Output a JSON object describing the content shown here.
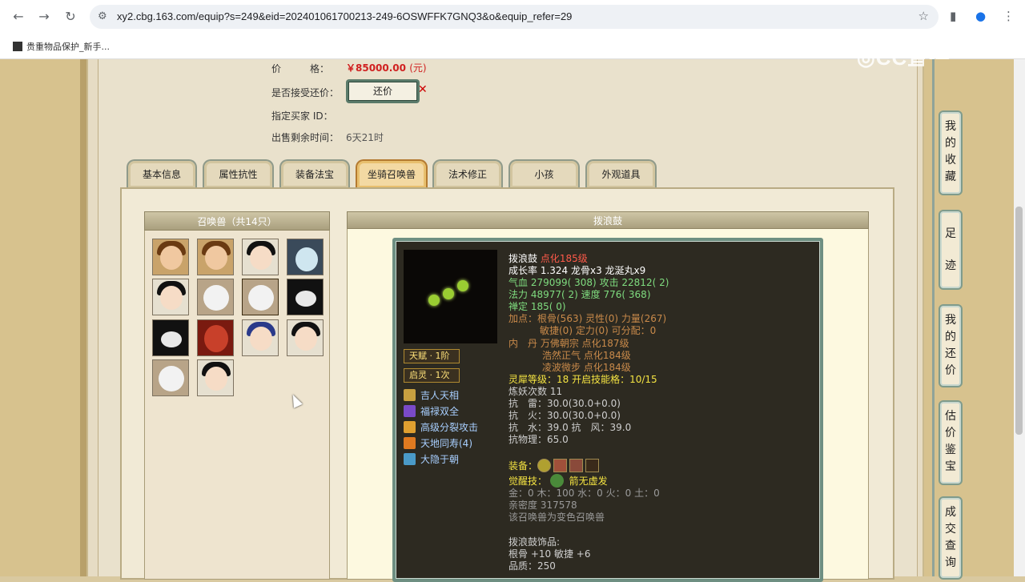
{
  "browser": {
    "url": "xy2.cbg.163.com/equip?s=249&eid=202401061700213-249-6OSWFFK7GNQ3&o&equip_refer=29",
    "bookmark": "贵重物品保护_新手...",
    "watermark": "CC直播"
  },
  "info": {
    "price_label": "价　　　格：",
    "price_value": "￥85000.00",
    "price_unit": "(元)",
    "bargain_label": "是否接受还价：",
    "bargain_button": "还价",
    "buyer_label": "指定买家 ID：",
    "time_label": "出售剩余时间：",
    "time_value": "6天21时"
  },
  "tabs": [
    "基本信息",
    "属性抗性",
    "装备法宝",
    "坐骑召唤兽",
    "法术修正",
    "小孩",
    "外观道具"
  ],
  "active_tab": "坐骑召唤兽",
  "pet_list": {
    "title": "召唤兽（共14只）",
    "count": 14
  },
  "detail": {
    "title": "拨浪鼓",
    "badge1": "天赋 · 1阶",
    "badge2": "启灵 · 1次",
    "skills": [
      "吉人天相",
      "福禄双全",
      "高级分裂攻击",
      "天地同寿(4)",
      "大隐于朝"
    ],
    "name": "拨浪鼓",
    "level": "点化185级",
    "growth": "成长率 1.324 龙骨x3 龙涎丸x9",
    "hp_label": "气血",
    "hp": "279099( 308)",
    "atk_label": "攻击",
    "atk": "22812( 2)",
    "mp_label": "法力",
    "mp": "48977( 2)",
    "spd_label": "速度",
    "spd": "776( 368)",
    "zen_label": "禅定",
    "zen": "185( 0)",
    "points_line1": "加点：根骨(563) 灵性(0) 力量(267)",
    "points_line2": "敏捷(0) 定力(0) 可分配：0",
    "neidan_label": "内　丹",
    "neidan1": "万佛朝宗 点化187级",
    "neidan2": "浩然正气 点化184级",
    "neidan3": "凌波微步 点化184级",
    "lingxi": "灵犀等级：18 开启技能格：10/15",
    "lianyao": "炼妖次数 11",
    "res1": "抗　雷：30.0(30.0+0.0)",
    "res2": "抗　火：30.0(30.0+0.0)",
    "res3": "抗　水：39.0 抗　风：39.0",
    "res4": "抗物理：65.0",
    "equip_label": "装备：",
    "awaken_label": "觉醒技：",
    "awaken_skill": "箭无虚发",
    "elements": "金：0 木：100 水：0 火：0 土：0",
    "intimacy": "亲密度 317578",
    "variant": "该召唤兽为变色召唤兽",
    "ornament": "拨浪鼓饰品:",
    "orn_stats": "根骨 +10 敏捷 +6",
    "quality": "品质：250"
  },
  "sidebar": [
    "我的收藏",
    "足迹",
    "我的还价",
    "估价鉴宝",
    "成交查询"
  ]
}
